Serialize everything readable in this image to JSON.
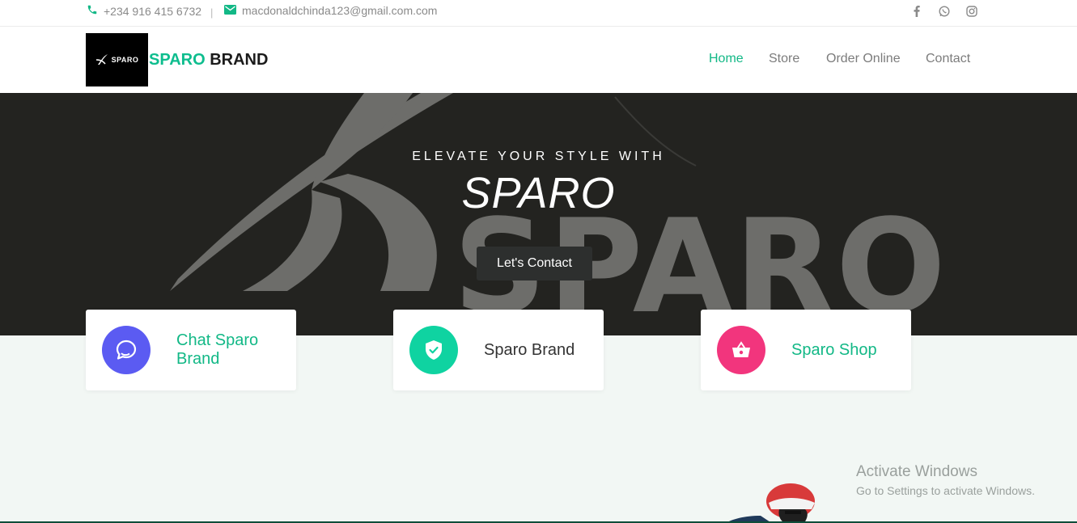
{
  "topbar": {
    "phone": "+234 916 415 6732",
    "separator": "|",
    "email": "macdonaldchinda123@gmail.com.com",
    "social": [
      "facebook-icon",
      "whatsapp-icon",
      "instagram-icon"
    ]
  },
  "header": {
    "logo_text": "SPARO",
    "brand_part1": "SPARO",
    "brand_part2": "BRAND",
    "nav": [
      {
        "label": "Home",
        "active": true
      },
      {
        "label": "Store",
        "active": false
      },
      {
        "label": "Order Online",
        "active": false
      },
      {
        "label": "Contact",
        "active": false
      }
    ]
  },
  "hero": {
    "eyebrow": "ELEVATE YOUR STYLE WITH",
    "title": "SPARO",
    "button": "Let's Contact"
  },
  "features": [
    {
      "label": "Chat Sparo Brand",
      "icon": "chat-icon",
      "color": "#5b5bf2",
      "text_color": "#12b886"
    },
    {
      "label": "Sparo Brand",
      "icon": "shield-check-icon",
      "color": "#0fd3a1",
      "text_color": "#333333"
    },
    {
      "label": "Sparo Shop",
      "icon": "basket-icon",
      "color": "#f2357d",
      "text_color": "#12b886"
    }
  ],
  "watermark": {
    "title": "Activate Windows",
    "subtitle": "Go to Settings to activate Windows."
  },
  "colors": {
    "accent": "#12b886",
    "hero_bg": "#232320"
  }
}
